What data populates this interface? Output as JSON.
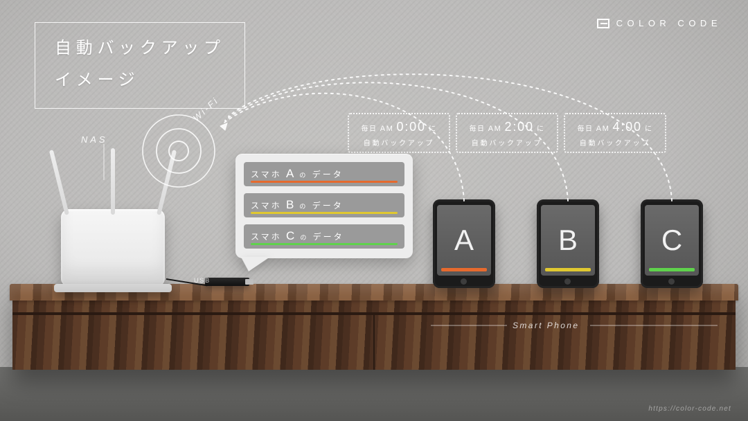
{
  "brand": {
    "name": "COLOR CODE"
  },
  "title": {
    "line1": "自動バックアップ",
    "line2": "イメージ"
  },
  "labels": {
    "nas": "NAS",
    "wifi": "Wi-Fi",
    "usb": "USB",
    "smartphone": "Smart Phone"
  },
  "schedules": [
    {
      "prefix": "毎日 ",
      "ampm": "AM",
      "time": "0:00",
      "suffix": " に",
      "line2": "自動バックアップ"
    },
    {
      "prefix": "毎日 ",
      "ampm": "AM",
      "time": "2:00",
      "suffix": " に",
      "line2": "自動バックアップ"
    },
    {
      "prefix": "毎日 ",
      "ampm": "AM",
      "time": "4:00",
      "suffix": " に",
      "line2": "自動バックアップ"
    }
  ],
  "data_bars": [
    {
      "pre": "スマホ",
      "mid": "A",
      "small": "の",
      "post": "データ",
      "color": "#e66a2e"
    },
    {
      "pre": "スマホ",
      "mid": "B",
      "small": "の",
      "post": "データ",
      "color": "#e0c830"
    },
    {
      "pre": "スマホ",
      "mid": "C",
      "small": "の",
      "post": "データ",
      "color": "#5fd24c"
    }
  ],
  "phones": [
    {
      "letter": "A",
      "color": "#e66a2e"
    },
    {
      "letter": "B",
      "color": "#e0c830"
    },
    {
      "letter": "C",
      "color": "#5fd24c"
    }
  ],
  "footer_url": "https://color-code.net"
}
